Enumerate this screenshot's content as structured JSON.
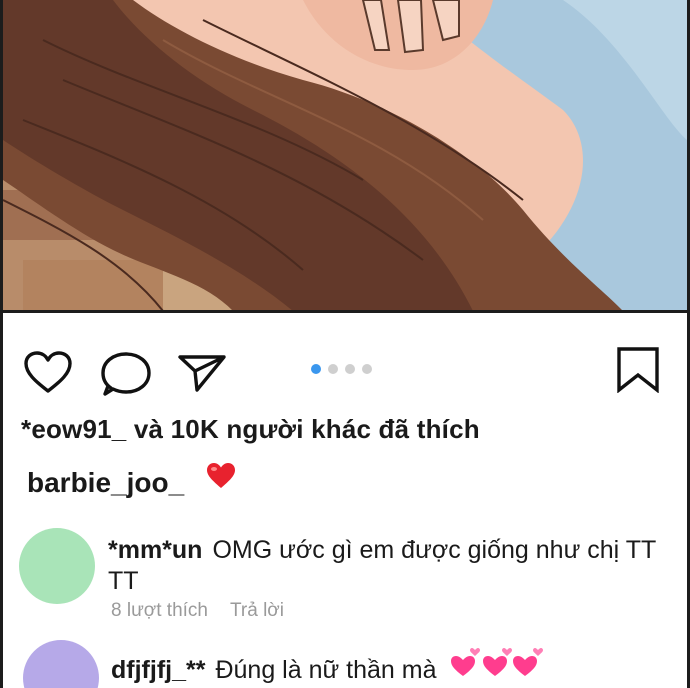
{
  "post": {
    "dots": [
      true,
      false,
      false,
      false
    ],
    "likes_text": "*eow91_ và 10K người khác đã thích",
    "caption": {
      "username": "barbie_joo_",
      "emoji": "heart-emoji"
    }
  },
  "comments": [
    {
      "username": "*mm*un",
      "text": "OMG ước gì em được giống như chị TT TT",
      "likes": "8 lượt thích",
      "reply_label": "Trả lời",
      "avatar_color": "#a9e4b8"
    },
    {
      "username": "dfjfjfj_**",
      "text": "Đúng là nữ thần mà",
      "emoji": "pink-hearts-emoji",
      "avatar_color": "#b6a9e8"
    }
  ],
  "colors": {
    "active_dot": "#3a97ee",
    "inactive_dot": "#cfcfcf",
    "meta_text": "#9a9a9a"
  }
}
